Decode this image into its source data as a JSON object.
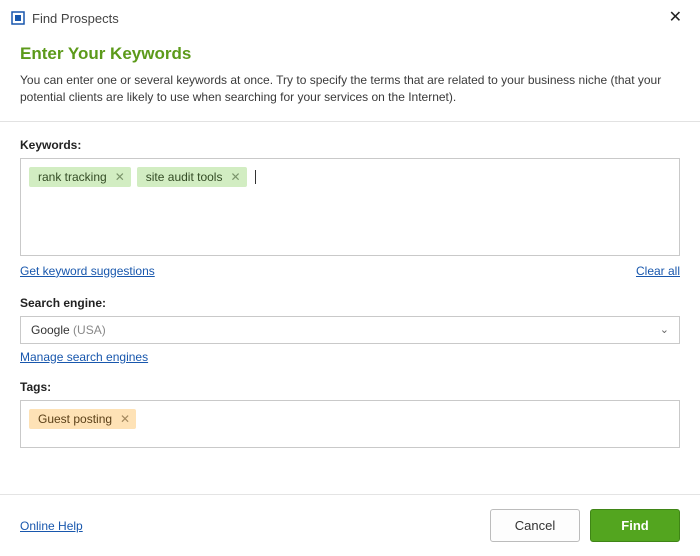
{
  "window": {
    "title": "Find Prospects"
  },
  "header": {
    "heading": "Enter Your Keywords",
    "intro": "You can enter one or several keywords at once. Try to specify the terms that are related to your business niche (that your potential clients are likely to use when searching for your services on the Internet)."
  },
  "keywords": {
    "label": "Keywords:",
    "chips": [
      {
        "text": "rank tracking"
      },
      {
        "text": "site audit tools"
      }
    ],
    "suggestions_link": "Get keyword suggestions",
    "clear_all": "Clear all"
  },
  "search_engine": {
    "label": "Search engine:",
    "value_primary": "Google",
    "value_secondary": " (USA)",
    "manage_link": "Manage search engines"
  },
  "tags": {
    "label": "Tags:",
    "chips": [
      {
        "text": "Guest posting"
      }
    ]
  },
  "footer": {
    "help_link": "Online Help",
    "cancel": "Cancel",
    "find": "Find"
  }
}
